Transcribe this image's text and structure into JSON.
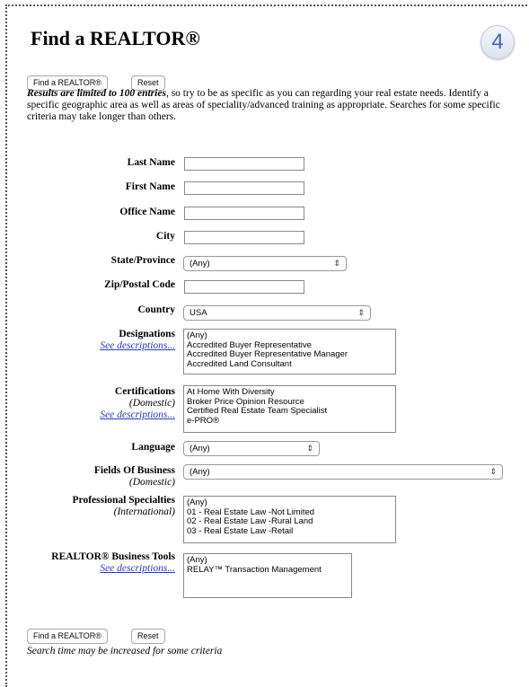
{
  "page": {
    "title": "Find a REALTOR®",
    "step_badge": "4"
  },
  "buttons": {
    "find": "Find a REALTOR®",
    "reset": "Reset"
  },
  "intro": {
    "bold_part": "Results are limited to 100 entries",
    "rest": ", so try to be as specific as you can regarding your real estate needs. Identify a specific geographic area as well as areas of speciality/advanced training as appropriate. Searches for some specific criteria may take longer than others."
  },
  "fields": {
    "last_name": {
      "label": "Last Name",
      "value": ""
    },
    "first_name": {
      "label": "First Name",
      "value": ""
    },
    "office_name": {
      "label": "Office Name",
      "value": ""
    },
    "city": {
      "label": "City",
      "value": ""
    },
    "state": {
      "label": "State/Province",
      "value": "(Any)"
    },
    "zip": {
      "label": "Zip/Postal Code",
      "value": ""
    },
    "country": {
      "label": "Country",
      "value": "USA"
    },
    "language": {
      "label": "Language",
      "value": "(Any)"
    },
    "fields_of_business": {
      "label": "Fields Of Business",
      "sub": "(Domestic)",
      "value": "(Any)"
    }
  },
  "designations": {
    "label": "Designations",
    "link": "See descriptions...",
    "options": [
      "(Any)",
      "Accredited Buyer Representative",
      "Accredited Buyer Representative Manager",
      "Accredited Land Consultant"
    ]
  },
  "certifications": {
    "label": "Certifications",
    "sub": "(Domestic)",
    "link": "See descriptions...",
    "options": [
      "At Home With Diversity",
      "Broker Price Opinion Resource",
      "Certified Real Estate Team Specialist",
      "e-PRO®"
    ]
  },
  "specialties": {
    "label": "Professional Specialties",
    "sub": "(International)",
    "options": [
      "(Any)",
      "01 - Real Estate Law -Not Limited",
      "02 - Real Estate Law -Rural Land",
      "03 - Real Estate Law -Retail"
    ]
  },
  "tools": {
    "label": "REALTOR® Business Tools",
    "link": "See descriptions...",
    "options": [
      "(Any)",
      "RELAY™ Transaction Management"
    ]
  },
  "footer_note": "Search time may be increased for some criteria",
  "icons": {
    "select_arrow": "select-arrow-icon"
  }
}
